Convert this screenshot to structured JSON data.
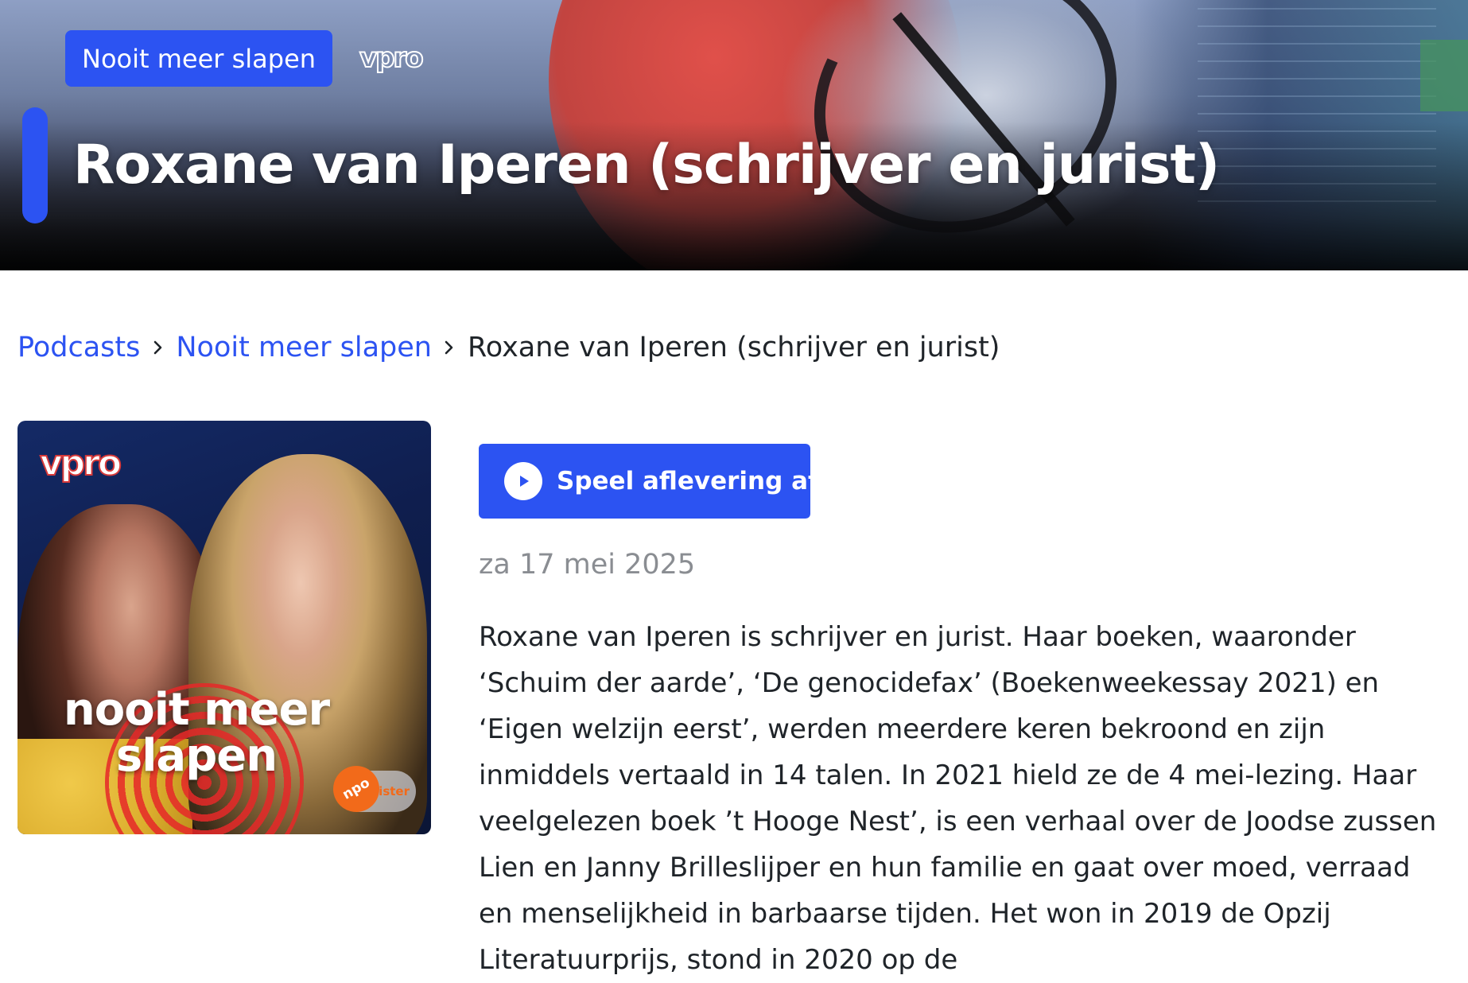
{
  "hero": {
    "tag_label": "Nooit meer slapen",
    "broadcaster_logo_text": "vpro",
    "title": "Roxane van Iperen (schrijver en jurist)"
  },
  "breadcrumb": {
    "items": [
      {
        "label": "Podcasts"
      },
      {
        "label": "Nooit meer slapen"
      }
    ],
    "current": "Roxane van Iperen (schrijver en jurist)"
  },
  "cover": {
    "logo_text": "vpro",
    "title_line1": "nooit meer",
    "title_line2": "slapen",
    "badge_npo": "npo",
    "badge_luister": "luister"
  },
  "episode": {
    "play_label": "Speel aflevering af",
    "date": "za 17 mei 2025",
    "description": "Roxane van Iperen is schrijver en jurist. Haar boeken, waaronder ‘Schuim der aarde’, ‘De genocidefax’ (Boekenweekessay 2021) en ‘Eigen welzijn eerst’, werden meerdere keren bekroond en zijn inmiddels vertaald in 14 talen. In 2021 hield ze de 4 mei-lezing. Haar veelgelezen boek ’t Hooge Nest’, is een verhaal over de Joodse zussen Lien en Janny Brilleslijper en hun familie en gaat over moed, verraad en menselijkheid in barbaarse tijden. Het won in 2019 de Opzij Literatuurprijs, stond in 2020 op de"
  },
  "icons": {
    "breadcrumb_separator": "chevron-right-icon",
    "play": "play-icon"
  },
  "colors": {
    "accent": "#2c53f2",
    "text": "#1f2429",
    "muted": "#8a8d92"
  }
}
